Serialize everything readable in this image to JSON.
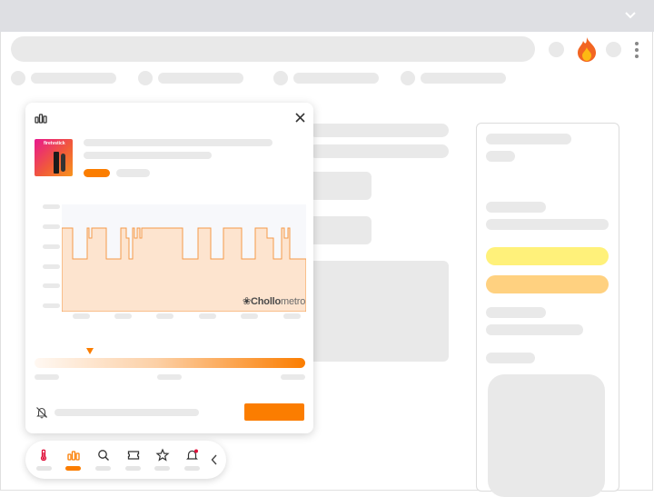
{
  "popup": {
    "watermark": {
      "brand_bold": "Chollo",
      "brand_light": "metro"
    },
    "product": {
      "thumbnail_text": "firetvstick"
    },
    "close_icon": "close-icon",
    "header_icon": "bar-chart-icon",
    "footer_icon": "bell-off-icon"
  },
  "toolbar": {
    "items": [
      "thermometer-icon",
      "bar-chart-icon",
      "search-icon",
      "ticket-icon",
      "star-icon",
      "bell-icon"
    ],
    "active_index": 1,
    "collapse_icon": "chevron-left-icon"
  },
  "colors": {
    "accent": "#fb7d00",
    "chart_fill": "#fde4cf",
    "yellow_pill": "#fff17a",
    "orange_pill": "#ffd180",
    "flame_outer": "#f26522",
    "flame_inner": "#fdb913"
  }
}
